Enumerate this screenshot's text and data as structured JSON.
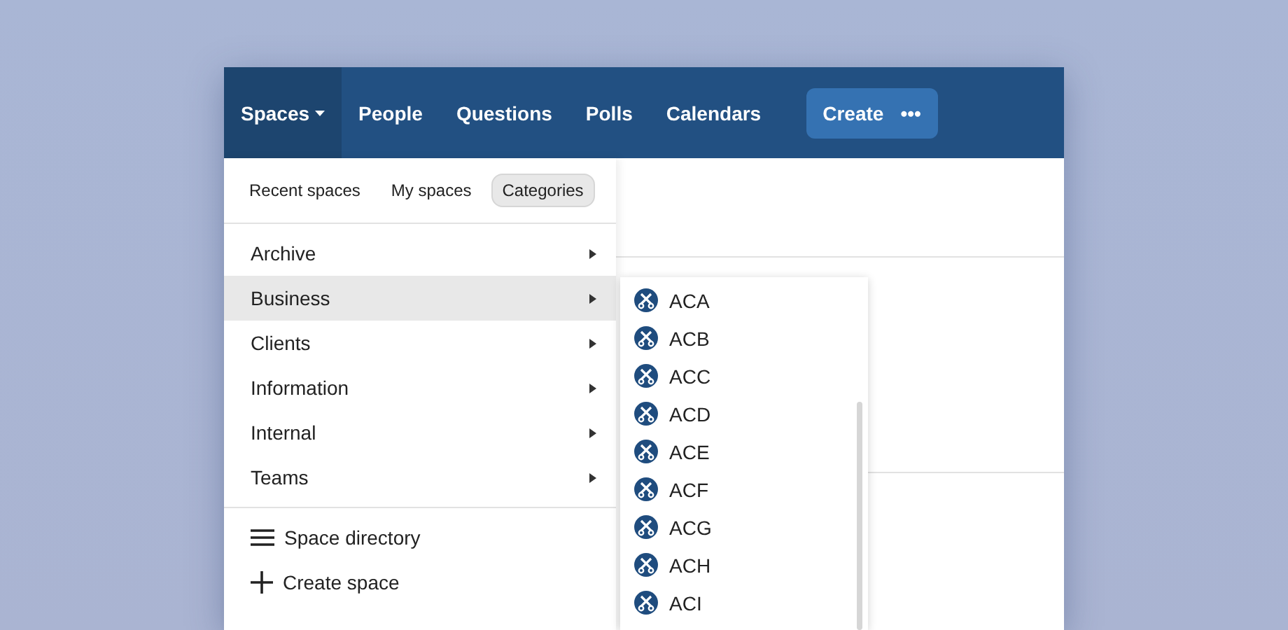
{
  "navbar": {
    "items": [
      {
        "label": "Spaces",
        "selected": true,
        "has_caret": true
      },
      {
        "label": "People",
        "selected": false,
        "has_caret": false
      },
      {
        "label": "Questions",
        "selected": false,
        "has_caret": false
      },
      {
        "label": "Polls",
        "selected": false,
        "has_caret": false
      },
      {
        "label": "Calendars",
        "selected": false,
        "has_caret": false
      }
    ],
    "create_button": {
      "label": "Create",
      "more": "•••"
    }
  },
  "spaces_menu": {
    "tabs": [
      {
        "label": "Recent spaces",
        "selected": false
      },
      {
        "label": "My spaces",
        "selected": false
      },
      {
        "label": "Categories",
        "selected": true
      }
    ],
    "categories": [
      {
        "label": "Archive",
        "selected": false
      },
      {
        "label": "Business",
        "selected": true
      },
      {
        "label": "Clients",
        "selected": false
      },
      {
        "label": "Information",
        "selected": false
      },
      {
        "label": "Internal",
        "selected": false
      },
      {
        "label": "Teams",
        "selected": false
      }
    ],
    "actions": [
      {
        "kind": "directory",
        "label": "Space directory"
      },
      {
        "kind": "create",
        "label": "Create space"
      }
    ]
  },
  "submenu": {
    "items": [
      {
        "label": "ACA"
      },
      {
        "label": "ACB"
      },
      {
        "label": "ACC"
      },
      {
        "label": "ACD"
      },
      {
        "label": "ACE"
      },
      {
        "label": "ACF"
      },
      {
        "label": "ACG"
      },
      {
        "label": "ACH"
      },
      {
        "label": "ACI"
      }
    ]
  }
}
